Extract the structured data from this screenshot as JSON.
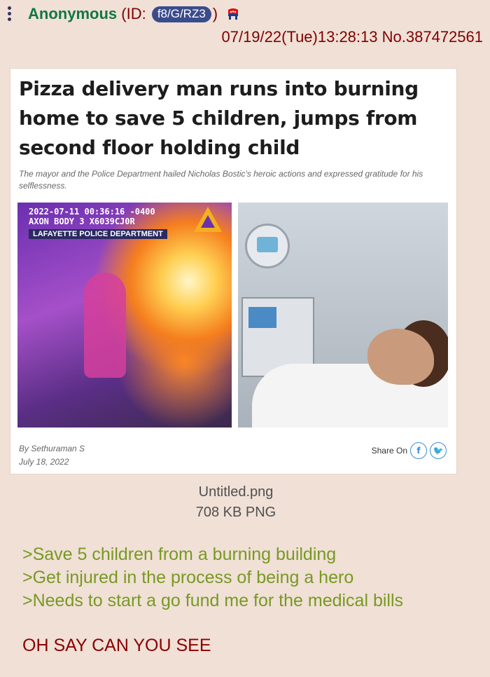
{
  "post": {
    "name": "Anonymous",
    "id_label": "(ID:",
    "id": "f8/G/RZ3",
    "id_close": ")",
    "flag_icon": "republican-elephant-icon",
    "datetime": "07/19/22(Tue)13:28:13",
    "post_number": "No.387472561"
  },
  "image": {
    "headline": "Pizza delivery man runs into burning home to save 5 children, jumps from second floor holding child",
    "subheadline": "The mayor and the Police Department hailed Nicholas Bostic's heroic actions and expressed gratitude for his selflessness.",
    "bodycam_line1": "2022-07-11 00:36:16 -0400",
    "bodycam_line2": "AXON BODY 3 X6039CJ0R",
    "bodycam_dept": "LAFAYETTE POLICE DEPARTMENT",
    "author": "By Sethuraman S",
    "date": "July 18, 2022",
    "share_label": "Share On",
    "share_facebook": "f",
    "share_twitter": "🐦"
  },
  "file": {
    "filename": "Untitled.png",
    "size": "708 KB PNG"
  },
  "comment": {
    "greentext": [
      ">Save 5 children from a burning building",
      ">Get injured in the process of being a hero",
      ">Needs to start a go fund me for the medical bills"
    ],
    "body": "OH SAY CAN YOU SEE"
  },
  "colors": {
    "background": "#f0e0d6",
    "name": "#117743",
    "id_badge": "#3b4c8c",
    "dateline": "#800000",
    "greentext": "#789922",
    "body_text": "#8b0000"
  }
}
